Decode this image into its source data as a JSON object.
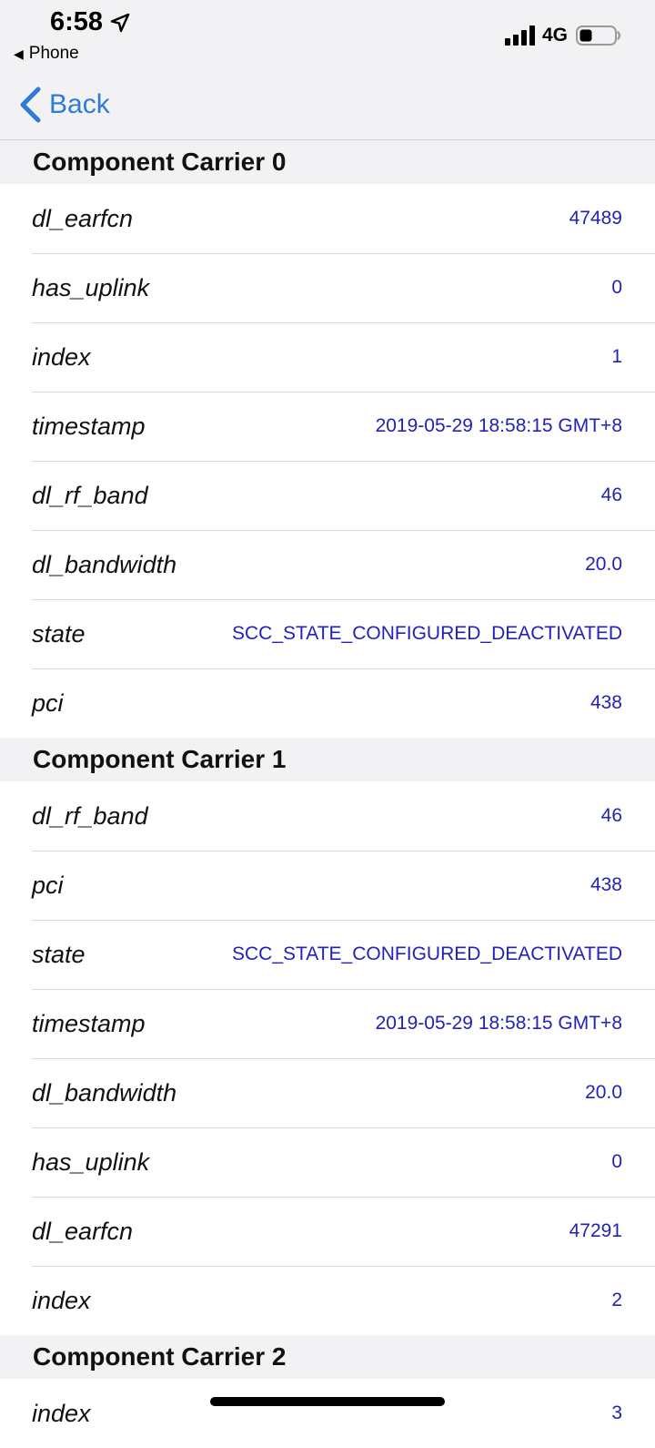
{
  "status_bar": {
    "time": "6:58",
    "back_app_label": "Phone",
    "network": "4G"
  },
  "nav": {
    "back_label": "Back"
  },
  "sections": [
    {
      "title": "Component Carrier 0",
      "rows": [
        {
          "key": "dl_earfcn",
          "value": "47489"
        },
        {
          "key": "has_uplink",
          "value": "0"
        },
        {
          "key": "index",
          "value": "1"
        },
        {
          "key": "timestamp",
          "value": "2019-05-29 18:58:15 GMT+8"
        },
        {
          "key": "dl_rf_band",
          "value": "46"
        },
        {
          "key": "dl_bandwidth",
          "value": "20.0"
        },
        {
          "key": "state",
          "value": "SCC_STATE_CONFIGURED_DEACTIVATED"
        },
        {
          "key": "pci",
          "value": "438"
        }
      ]
    },
    {
      "title": "Component Carrier 1",
      "rows": [
        {
          "key": "dl_rf_band",
          "value": "46"
        },
        {
          "key": "pci",
          "value": "438"
        },
        {
          "key": "state",
          "value": "SCC_STATE_CONFIGURED_DEACTIVATED"
        },
        {
          "key": "timestamp",
          "value": "2019-05-29 18:58:15 GMT+8"
        },
        {
          "key": "dl_bandwidth",
          "value": "20.0"
        },
        {
          "key": "has_uplink",
          "value": "0"
        },
        {
          "key": "dl_earfcn",
          "value": "47291"
        },
        {
          "key": "index",
          "value": "2"
        }
      ]
    },
    {
      "title": "Component Carrier 2",
      "rows": [
        {
          "key": "index",
          "value": "3"
        }
      ]
    }
  ],
  "colors": {
    "accent": "#2f7ad7",
    "value_text": "#2222bb",
    "section_background": "#f2f2f4",
    "row_background": "#ffffff"
  },
  "icons": [
    "location-arrow-icon",
    "signal-bars-icon",
    "battery-icon",
    "chevron-left-icon"
  ]
}
